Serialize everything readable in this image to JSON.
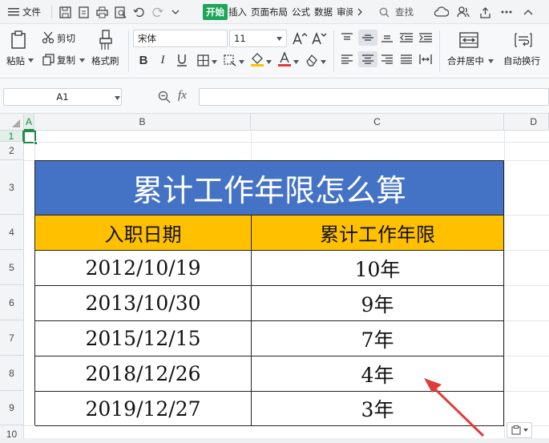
{
  "menu": {
    "file": "文件"
  },
  "tabs": [
    {
      "label": "开始",
      "active": true
    },
    {
      "label": "插入"
    },
    {
      "label": "页面布局"
    },
    {
      "label": "公式"
    },
    {
      "label": "数据"
    },
    {
      "label": "审阅"
    }
  ],
  "search": {
    "label": "查找"
  },
  "ribbon": {
    "paste": "粘贴",
    "cut": "剪切",
    "copy": "复制",
    "format_painter": "格式刷",
    "font_name": "宋体",
    "font_size": "11",
    "merge_center": "合并居中",
    "auto_wrap": "自动换行"
  },
  "formula_bar": {
    "name_box": "A1",
    "fx": "fx",
    "formula": ""
  },
  "columns": [
    "A",
    "B",
    "C",
    "D"
  ],
  "rows": [
    "1",
    "2",
    "3",
    "4",
    "5",
    "6",
    "7",
    "8",
    "9",
    "10"
  ],
  "table": {
    "title": "累计工作年限怎么算",
    "headers": [
      "入职日期",
      "累计工作年限"
    ],
    "rows": [
      [
        "2012/10/19",
        "10年"
      ],
      [
        "2013/10/30",
        "9年"
      ],
      [
        "2015/12/15",
        "7年"
      ],
      [
        "2018/12/26",
        "4年"
      ],
      [
        "2019/12/27",
        "3年"
      ]
    ]
  },
  "colors": {
    "title_bg": "#4472c4",
    "header_bg": "#ffc000",
    "active_tab": "#1fa55a",
    "arrow": "#e23b3b"
  }
}
